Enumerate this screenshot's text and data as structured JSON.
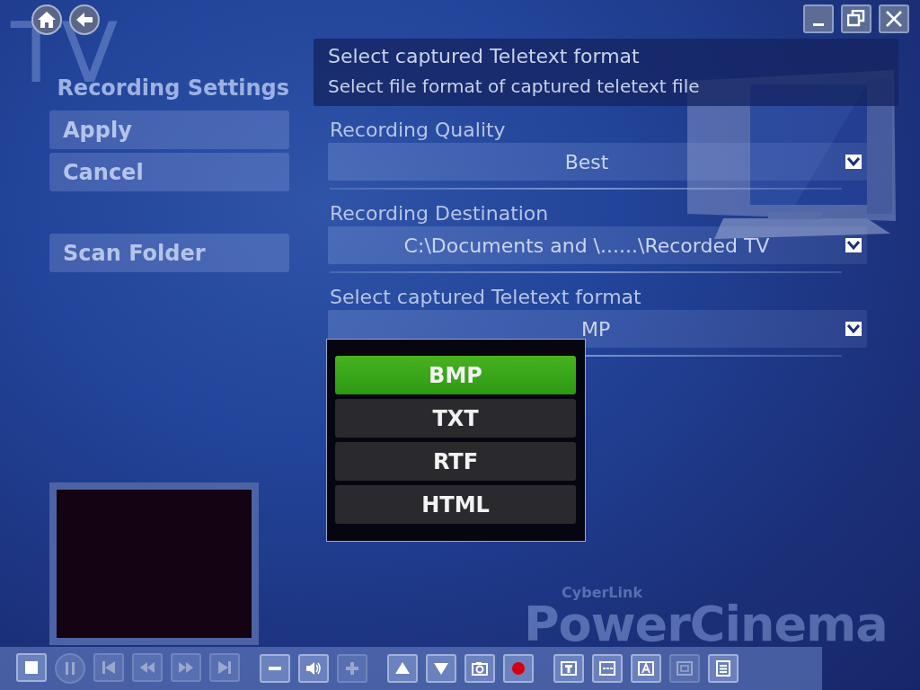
{
  "backdrop_title": "TV",
  "nav_buttons": [
    {
      "kind": "home"
    },
    {
      "kind": "back"
    }
  ],
  "window_buttons": [
    {
      "kind": "minimize"
    },
    {
      "kind": "restore"
    },
    {
      "kind": "close"
    }
  ],
  "page_title": "Recording Settings",
  "side_button_groups": [
    [
      {
        "label": "Apply"
      },
      {
        "label": "Cancel"
      }
    ],
    [
      {
        "label": "Scan Folder"
      }
    ]
  ],
  "info": {
    "title": "Select captured Teletext format",
    "description": "Select file format of captured teletext file"
  },
  "settings": [
    {
      "label": "Recording Quality",
      "value": "Best"
    },
    {
      "label": "Recording Destination",
      "value": "C:\\Documents and \\......\\Recorded TV"
    },
    {
      "label": "Select captured Teletext format",
      "value": "MP",
      "expanded": true
    }
  ],
  "dropdown_options": [
    {
      "label": "BMP",
      "selected": true
    },
    {
      "label": "TXT",
      "selected": false
    },
    {
      "label": "RTF",
      "selected": false
    },
    {
      "label": "HTML",
      "selected": false
    }
  ],
  "brand": {
    "small": "CyberLink",
    "large": "PowerCinema"
  },
  "toolbar_groups": [
    [
      {
        "kind": "stop",
        "disabled": false
      },
      {
        "kind": "pause",
        "disabled": true
      },
      {
        "kind": "previous",
        "disabled": true
      },
      {
        "kind": "rewind",
        "disabled": true
      },
      {
        "kind": "forward",
        "disabled": true
      },
      {
        "kind": "next",
        "disabled": true
      }
    ],
    [
      {
        "kind": "volume-down",
        "disabled": false
      },
      {
        "kind": "volume",
        "disabled": false
      },
      {
        "kind": "volume-up",
        "disabled": true
      }
    ],
    [
      {
        "kind": "up",
        "disabled": false
      },
      {
        "kind": "down",
        "disabled": false
      },
      {
        "kind": "snapshot",
        "disabled": false
      },
      {
        "kind": "record",
        "disabled": false
      }
    ],
    [
      {
        "kind": "teletext",
        "disabled": false
      },
      {
        "kind": "subtitles",
        "disabled": false
      },
      {
        "kind": "caption",
        "disabled": false
      },
      {
        "kind": "pip",
        "disabled": true
      },
      {
        "kind": "menu",
        "disabled": false
      }
    ]
  ]
}
